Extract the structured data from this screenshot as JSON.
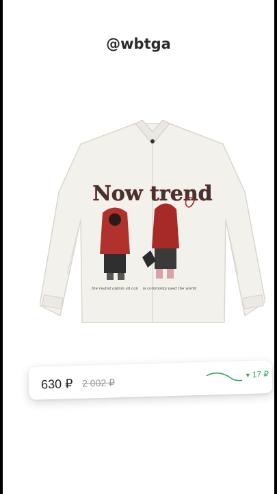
{
  "header": {
    "handle": "@wbtga"
  },
  "product": {
    "print_title": "Now trend",
    "caption_left": "the realist option all can",
    "caption_right": "is commonly used the world"
  },
  "price_card": {
    "price": "630 ₽",
    "old_price": "2 002 ₽",
    "delta": "17 ₽",
    "delta_color": "#2ea55c"
  }
}
